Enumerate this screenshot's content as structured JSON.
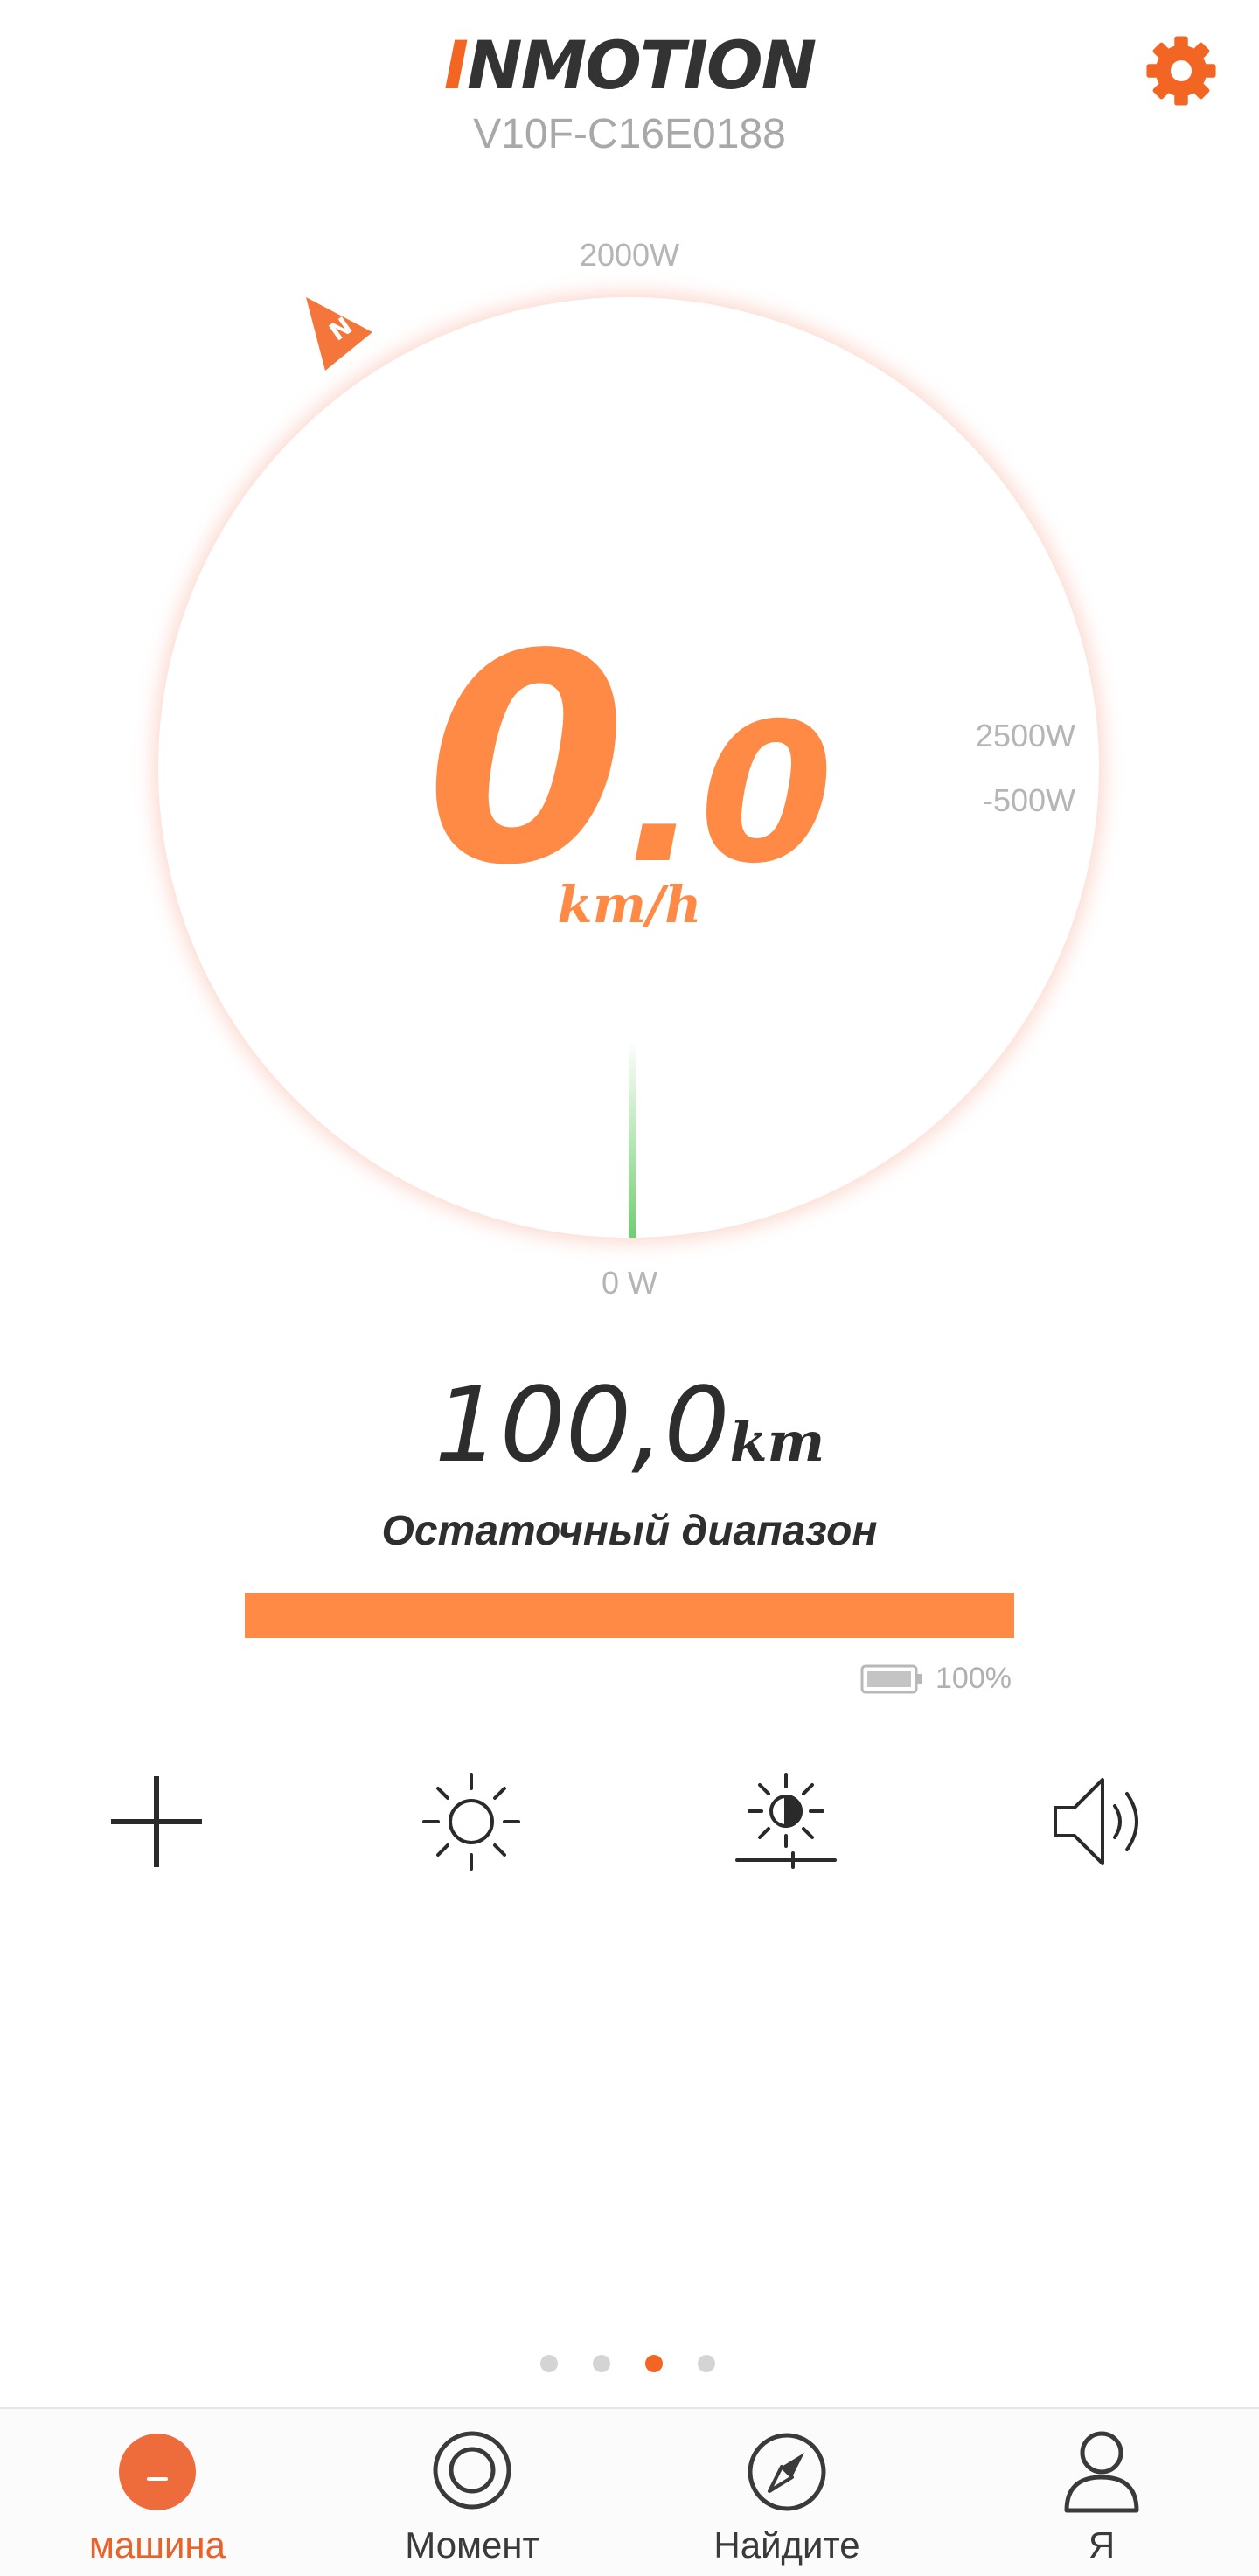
{
  "header": {
    "logo_accent": "I",
    "logo_text": "NMOTION",
    "device_id": "V10F-C16E0188",
    "settings_icon": "gear-icon"
  },
  "gauge": {
    "power_labels": {
      "top": "2000W",
      "bottom": "0 W",
      "right_max": "2500W",
      "right_min": "-500W"
    },
    "compass_letter": "N",
    "speed_int": "0",
    "speed_sep": ".",
    "speed_dec": "0",
    "speed_unit": "km/h",
    "power_level": 0
  },
  "range": {
    "value": "100,0",
    "unit": "km",
    "caption": "Остаточный диапазон",
    "fill_fraction": 1.0,
    "battery_percent": "100%"
  },
  "controls": [
    {
      "icon": "plus-icon"
    },
    {
      "icon": "brightness-icon"
    },
    {
      "icon": "auto-brightness-icon"
    },
    {
      "icon": "speaker-icon"
    }
  ],
  "pager": {
    "count": 4,
    "active_index": 2
  },
  "nav": {
    "items": [
      {
        "label": "машина",
        "icon": "vehicle-icon",
        "active": true
      },
      {
        "label": "Момент",
        "icon": "moment-icon",
        "active": false
      },
      {
        "label": "Найдите",
        "icon": "compass-icon",
        "active": false
      },
      {
        "label": "Я",
        "icon": "profile-icon",
        "active": false
      }
    ]
  },
  "colors": {
    "accent": "#f26522",
    "speed": "#ff8a45",
    "needle": "#6fcf6f",
    "text_dark": "#2d2d2d",
    "text_muted": "#a8a8a8"
  }
}
